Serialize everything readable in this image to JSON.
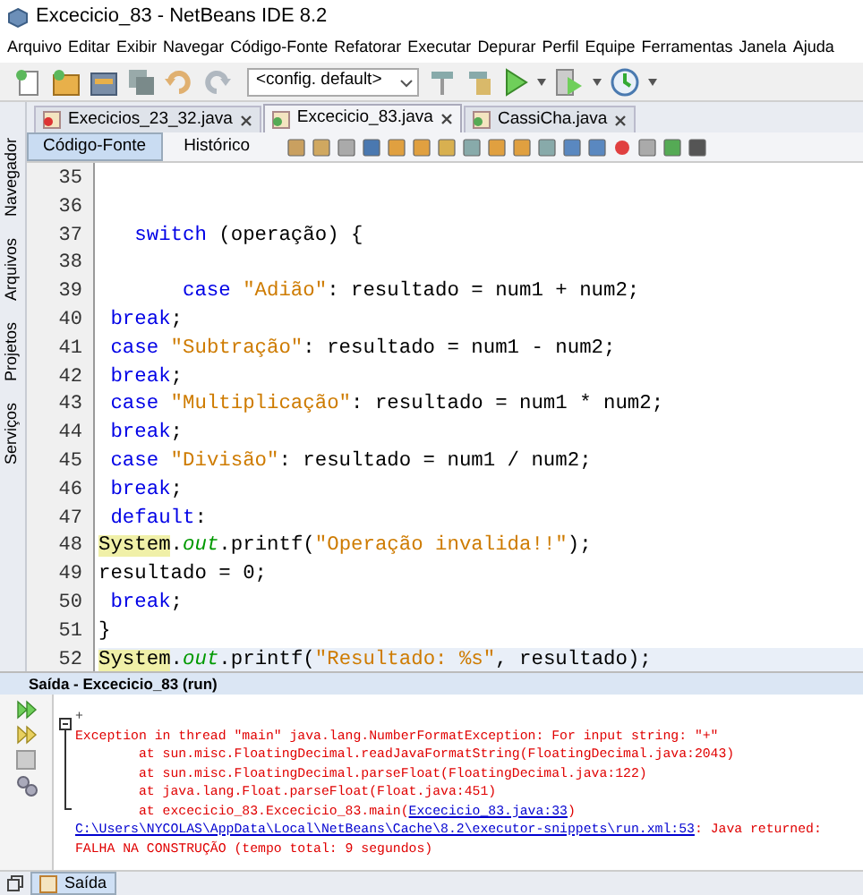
{
  "window": {
    "title": "Excecicio_83 - NetBeans IDE 8.2"
  },
  "menu": [
    "Arquivo",
    "Editar",
    "Exibir",
    "Navegar",
    "Código-Fonte",
    "Refatorar",
    "Executar",
    "Depurar",
    "Perfil",
    "Equipe",
    "Ferramentas",
    "Janela",
    "Ajuda"
  ],
  "toolbar": {
    "config": "<config. default>"
  },
  "editor_tabs": [
    {
      "label": "Execicios_23_32.java",
      "selected": false
    },
    {
      "label": "Excecicio_83.java",
      "selected": true
    },
    {
      "label": "CassiCha.java",
      "selected": false
    }
  ],
  "view_tabs": [
    {
      "label": "Código-Fonte",
      "selected": true
    },
    {
      "label": "Histórico",
      "selected": false
    }
  ],
  "side_tabs": [
    "Navegador",
    "Arquivos",
    "Projetos",
    "Serviços"
  ],
  "code_lines": [
    {
      "number": "35",
      "current": false
    },
    {
      "number": "36",
      "current": false
    },
    {
      "number": "37",
      "current": false,
      "tokens": [
        {
          "kind": "keyword",
          "text": "   switch"
        },
        {
          "kind": "plain",
          "text": " (operação) {"
        }
      ]
    },
    {
      "number": "38",
      "current": false
    },
    {
      "number": "39",
      "current": false,
      "tokens": [
        {
          "kind": "keyword",
          "text": "       case "
        },
        {
          "kind": "string",
          "text": "\"Adião\""
        },
        {
          "kind": "plain",
          "text": ": resultado = num1 + num2;"
        }
      ]
    },
    {
      "number": "40",
      "current": false,
      "tokens": [
        {
          "kind": "keyword",
          "text": " break"
        },
        {
          "kind": "plain",
          "text": ";"
        }
      ]
    },
    {
      "number": "41",
      "current": false,
      "tokens": [
        {
          "kind": "keyword",
          "text": " case "
        },
        {
          "kind": "string",
          "text": "\"Subtração\""
        },
        {
          "kind": "plain",
          "text": ": resultado = num1 - num2;"
        }
      ]
    },
    {
      "number": "42",
      "current": false,
      "tokens": [
        {
          "kind": "keyword",
          "text": " break"
        },
        {
          "kind": "plain",
          "text": ";"
        }
      ]
    },
    {
      "number": "43",
      "current": false,
      "tokens": [
        {
          "kind": "keyword",
          "text": " case "
        },
        {
          "kind": "string",
          "text": "\"Multiplicação\""
        },
        {
          "kind": "plain",
          "text": ": resultado = num1 * num2;"
        }
      ]
    },
    {
      "number": "44",
      "current": false,
      "tokens": [
        {
          "kind": "keyword",
          "text": " break"
        },
        {
          "kind": "plain",
          "text": ";"
        }
      ]
    },
    {
      "number": "45",
      "current": false,
      "tokens": [
        {
          "kind": "keyword",
          "text": " case "
        },
        {
          "kind": "string",
          "text": "\"Divisão\""
        },
        {
          "kind": "plain",
          "text": ": resultado = num1 / num2;"
        }
      ]
    },
    {
      "number": "46",
      "current": false,
      "tokens": [
        {
          "kind": "keyword",
          "text": " break"
        },
        {
          "kind": "plain",
          "text": ";"
        }
      ]
    },
    {
      "number": "47",
      "current": false,
      "tokens": [
        {
          "kind": "keyword",
          "text": " default"
        },
        {
          "kind": "plain",
          "text": ":"
        }
      ]
    },
    {
      "number": "48",
      "current": false,
      "tokens": [
        {
          "kind": "marked",
          "text": "System"
        },
        {
          "kind": "plain",
          "text": "."
        },
        {
          "kind": "field",
          "text": "out"
        },
        {
          "kind": "plain",
          "text": ".printf("
        },
        {
          "kind": "string",
          "text": "\"Operação invalida!!\""
        },
        {
          "kind": "plain",
          "text": ");"
        }
      ]
    },
    {
      "number": "49",
      "current": false,
      "tokens": [
        {
          "kind": "plain",
          "text": "resultado = 0;"
        }
      ]
    },
    {
      "number": "50",
      "current": false,
      "tokens": [
        {
          "kind": "keyword",
          "text": " break"
        },
        {
          "kind": "plain",
          "text": ";"
        }
      ]
    },
    {
      "number": "51",
      "current": false,
      "tokens": [
        {
          "kind": "plain",
          "text": "}"
        }
      ]
    },
    {
      "number": "52",
      "current": true,
      "tokens": [
        {
          "kind": "marked",
          "text": "System"
        },
        {
          "kind": "plain",
          "text": "."
        },
        {
          "kind": "field",
          "text": "out"
        },
        {
          "kind": "plain",
          "text": ".printf("
        },
        {
          "kind": "string",
          "text": "\"Resultado: %s\""
        },
        {
          "kind": "plain",
          "text": ", resultado);"
        }
      ]
    }
  ],
  "output": {
    "title": "Saída - Excecicio_83 (run)",
    "lines": [
      {
        "tokens": [
          {
            "kind": "input",
            "text": "+"
          }
        ]
      },
      {
        "tokens": [
          {
            "kind": "error",
            "text": "Exception in thread \"main\" java.lang.NumberFormatException: For input string: \"+\""
          }
        ]
      },
      {
        "tokens": [
          {
            "kind": "error",
            "text": "        at sun.misc.FloatingDecimal.readJavaFormatString(FloatingDecimal.java:2043)"
          }
        ]
      },
      {
        "tokens": [
          {
            "kind": "error",
            "text": "        at sun.misc.FloatingDecimal.parseFloat(FloatingDecimal.java:122)"
          }
        ]
      },
      {
        "tokens": [
          {
            "kind": "error",
            "text": "        at java.lang.Float.parseFloat(Float.java:451)"
          }
        ]
      },
      {
        "tokens": [
          {
            "kind": "error",
            "text": "        at excecicio_83.Excecicio_83.main("
          },
          {
            "kind": "link",
            "text": "Excecicio_83.java:33"
          },
          {
            "kind": "error",
            "text": ")"
          }
        ]
      },
      {
        "tokens": [
          {
            "kind": "link",
            "text": "C:\\Users\\NYCOLAS\\AppData\\Local\\NetBeans\\Cache\\8.2\\executor-snippets\\run.xml:53"
          },
          {
            "kind": "error",
            "text": ": Java returned:"
          }
        ]
      },
      {
        "tokens": [
          {
            "kind": "error",
            "text": "FALHA NA CONSTRUÇÃO (tempo total: 9 segundos)"
          }
        ]
      }
    ]
  },
  "bottom_tab": "Saída"
}
